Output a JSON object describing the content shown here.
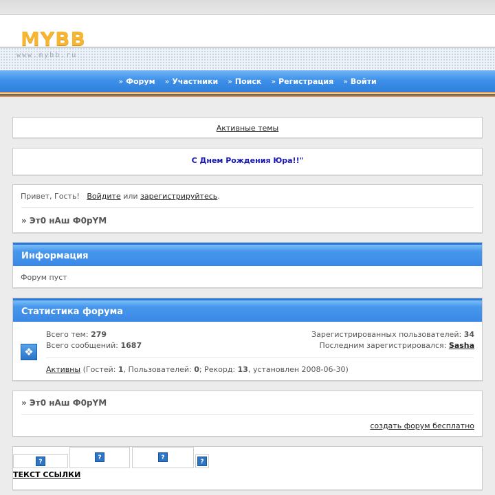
{
  "header": {
    "logo": "MYBB",
    "logo_url_text": "www.mybb.ru"
  },
  "nav": {
    "items": [
      {
        "label": "Форум"
      },
      {
        "label": "Участники"
      },
      {
        "label": "Поиск"
      },
      {
        "label": "Регистрация"
      },
      {
        "label": "Войти"
      }
    ],
    "marker": "»"
  },
  "active_topics": {
    "label": "Активные темы"
  },
  "announcement": {
    "text": "С Днем Рождения Юра!!\""
  },
  "welcome": {
    "greeting": "Привет, Гость!",
    "login_link": "Войдите",
    "or_text": "или",
    "register_link": "зарегистрируйтесь",
    "period": ".",
    "breadcrumb": "» Эт0 нАш Ф0рYМ"
  },
  "info": {
    "title": "Информация",
    "text": "Форум пуст"
  },
  "stats": {
    "title": "Статистика форума",
    "topics_label": "Всего тем:",
    "topics_value": "279",
    "posts_label": "Всего сообщений:",
    "posts_value": "1687",
    "registered_label": "Зарегистрированных пользователей:",
    "registered_value": "34",
    "last_registered_label": "Последним зарегистрировался:",
    "last_registered_value": "Sasha",
    "active_link": "Активны",
    "guests_label": "(Гостей:",
    "guests_value": "1",
    "users_label": ", Пользователей:",
    "users_value": "0",
    "record_label": "; Рекорд:",
    "record_value": "13",
    "record_tail": ", установлен 2008-06-30)"
  },
  "footer": {
    "breadcrumb": "» Эт0 нАш Ф0рYМ",
    "create_link": "создать форум бесплатно"
  },
  "banners": {
    "icon_glyph": "?",
    "link_text": "ТЕКСТ ССЫЛКИ"
  }
}
